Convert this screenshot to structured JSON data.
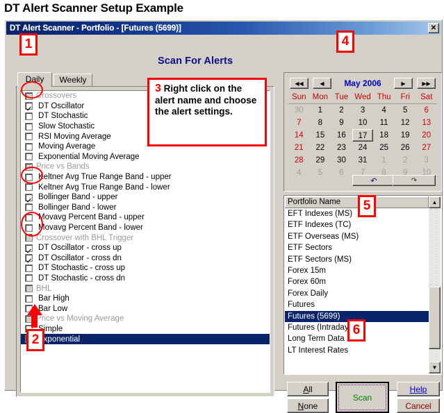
{
  "page_heading": "DT Alert Scanner Setup Example",
  "window": {
    "titlebar": "DT Alert Scanner - Portfolio - [Futures (5699)]",
    "close_label": "✕",
    "scan_title": "Scan For Alerts"
  },
  "tabs": [
    {
      "label": "Daily",
      "active": true
    },
    {
      "label": "Weekly",
      "active": false
    }
  ],
  "alerts": [
    {
      "label": "Crossovers",
      "type": "group",
      "checked": false
    },
    {
      "label": "DT Oscillator",
      "type": "item",
      "checked": true
    },
    {
      "label": "DT Stochastic",
      "type": "item",
      "checked": false
    },
    {
      "label": "Slow Stochastic",
      "type": "item",
      "checked": false
    },
    {
      "label": "RSI Moving Average",
      "type": "item",
      "checked": false
    },
    {
      "label": "Moving Average",
      "type": "item",
      "checked": false
    },
    {
      "label": "Exponential Moving Average",
      "type": "item",
      "checked": false
    },
    {
      "label": "Price vs Bands",
      "type": "group",
      "checked": false
    },
    {
      "label": "Keltner Avg True Range Band - upper",
      "type": "item",
      "checked": false
    },
    {
      "label": "Keltner Avg True Range Band - lower",
      "type": "item",
      "checked": false
    },
    {
      "label": "Bollinger Band - upper",
      "type": "item",
      "checked": true
    },
    {
      "label": "Bollinger Band - lower",
      "type": "item",
      "checked": false
    },
    {
      "label": "Movavg Percent Band - upper",
      "type": "item",
      "checked": false
    },
    {
      "label": "Movavg Percent Band - lower",
      "type": "item",
      "checked": false
    },
    {
      "label": "Crossover with BHL Trigger",
      "type": "group",
      "checked": false
    },
    {
      "label": "DT Oscillator - cross up",
      "type": "item",
      "checked": true
    },
    {
      "label": "DT Oscillator - cross dn",
      "type": "item",
      "checked": true
    },
    {
      "label": "DT Stochastic - cross up",
      "type": "item",
      "checked": false
    },
    {
      "label": "DT Stochastic - cross dn",
      "type": "item",
      "checked": false
    },
    {
      "label": "BHL",
      "type": "group",
      "checked": false
    },
    {
      "label": "Bar High",
      "type": "item",
      "checked": false
    },
    {
      "label": "Bar Low",
      "type": "item",
      "checked": false
    },
    {
      "label": "Price vs Moving Average",
      "type": "group",
      "checked": false
    },
    {
      "label": "Simple",
      "type": "item",
      "checked": false
    },
    {
      "label": "Exponential",
      "type": "item",
      "checked": false,
      "selected": true
    }
  ],
  "calendar": {
    "month_label": "May 2006",
    "first_label": "◀◀",
    "prev_label": "◀",
    "next_label": "▶",
    "last_label": "▶▶",
    "undo_label": "↶",
    "redo_label": "↷",
    "weekdays": [
      "Sun",
      "Mon",
      "Tue",
      "Wed",
      "Thu",
      "Fri",
      "Sat"
    ],
    "selected_day": 17,
    "weeks": [
      [
        {
          "d": 30,
          "in": false
        },
        {
          "d": 1,
          "in": true
        },
        {
          "d": 2,
          "in": true
        },
        {
          "d": 3,
          "in": true
        },
        {
          "d": 4,
          "in": true
        },
        {
          "d": 5,
          "in": true
        },
        {
          "d": 6,
          "in": true
        }
      ],
      [
        {
          "d": 7,
          "in": true
        },
        {
          "d": 8,
          "in": true
        },
        {
          "d": 9,
          "in": true
        },
        {
          "d": 10,
          "in": true
        },
        {
          "d": 11,
          "in": true
        },
        {
          "d": 12,
          "in": true
        },
        {
          "d": 13,
          "in": true
        }
      ],
      [
        {
          "d": 14,
          "in": true
        },
        {
          "d": 15,
          "in": true
        },
        {
          "d": 16,
          "in": true
        },
        {
          "d": 17,
          "in": true
        },
        {
          "d": 18,
          "in": true
        },
        {
          "d": 19,
          "in": true
        },
        {
          "d": 20,
          "in": true
        }
      ],
      [
        {
          "d": 21,
          "in": true
        },
        {
          "d": 22,
          "in": true
        },
        {
          "d": 23,
          "in": true
        },
        {
          "d": 24,
          "in": true
        },
        {
          "d": 25,
          "in": true
        },
        {
          "d": 26,
          "in": true
        },
        {
          "d": 27,
          "in": true
        }
      ],
      [
        {
          "d": 28,
          "in": true
        },
        {
          "d": 29,
          "in": true
        },
        {
          "d": 30,
          "in": true
        },
        {
          "d": 31,
          "in": true
        },
        {
          "d": 1,
          "in": false
        },
        {
          "d": 2,
          "in": false
        },
        {
          "d": 3,
          "in": false
        }
      ],
      [
        {
          "d": 4,
          "in": false
        },
        {
          "d": 5,
          "in": false
        },
        {
          "d": 6,
          "in": false
        },
        {
          "d": 7,
          "in": false
        },
        {
          "d": 8,
          "in": false
        },
        {
          "d": 9,
          "in": false
        },
        {
          "d": 10,
          "in": false
        }
      ]
    ]
  },
  "portfolio": {
    "header": "Portfolio Name",
    "selected": "Futures (5699)",
    "scroll_up_label": "▲",
    "scroll_down_label": "▼",
    "items": [
      "EFT Indexes (MS)",
      "ETF Indexes (TC)",
      "ETF Overseas (MS)",
      "ETF Sectors",
      "ETF Sectors (MS)",
      "Forex 15m",
      "Forex 60m",
      "Forex Daily",
      "Futures",
      "Futures (5699)",
      "Futures (Intraday)",
      "Long Term Data",
      "LT Interest Rates"
    ]
  },
  "buttons": {
    "all": {
      "accel": "A",
      "rest": "ll"
    },
    "none": {
      "accel": "N",
      "rest": "one"
    },
    "scan": "Scan",
    "help": {
      "accel": "H",
      "rest": "elp"
    },
    "cancel": "Cancel"
  },
  "annotations": {
    "n1": "1",
    "n2": "2",
    "n3_number": "3",
    "n3_text": " Right click on the alert name and choose the alert settings.",
    "n4": "4",
    "n5": "5",
    "n6": "6"
  },
  "colors": {
    "titlebar_start": "#0a246a",
    "titlebar_end": "#a7c8ec",
    "face": "#d4d0c8",
    "selection": "#0a246a",
    "heading_blue": "#0b0b8c",
    "annotation_red": "#ff0000",
    "scan_green": "#008000",
    "cancel_red": "#8b0000",
    "help_blue": "#0000cc",
    "weekend_red": "#cc0000"
  }
}
